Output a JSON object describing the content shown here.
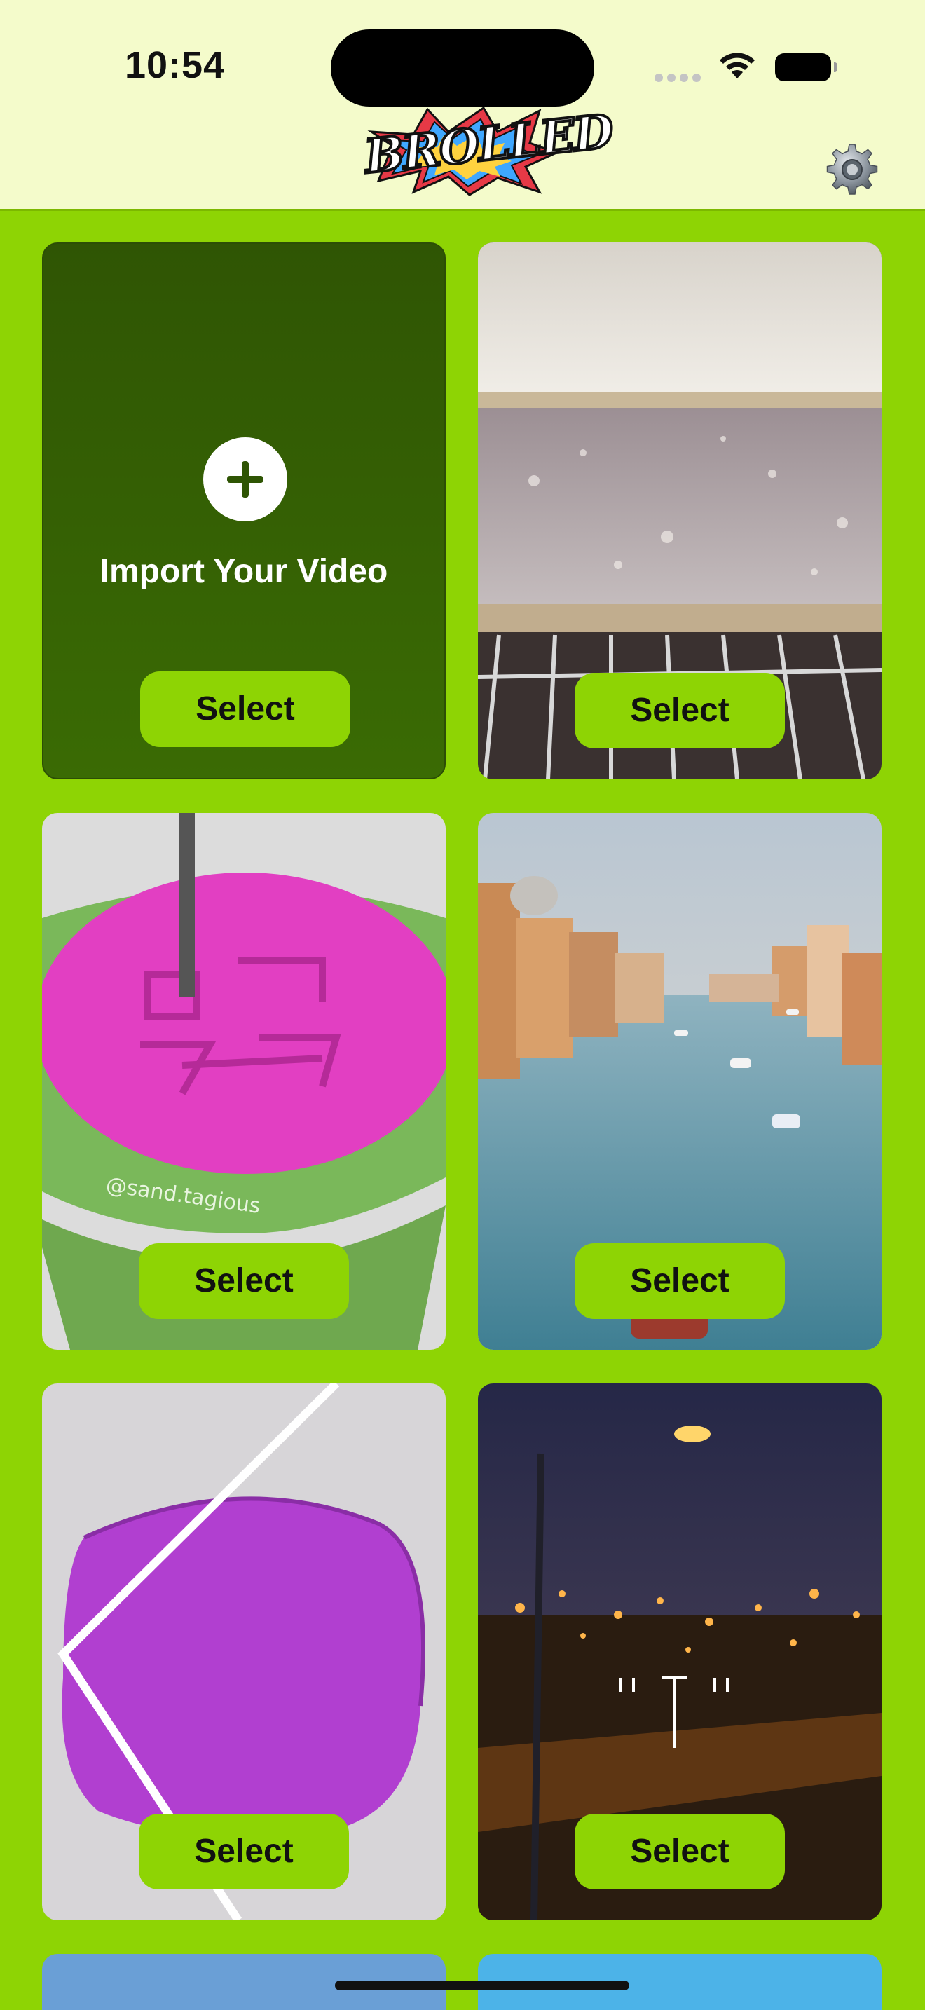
{
  "status_bar": {
    "time": "10:54"
  },
  "header": {
    "logo_text": "BROLLED",
    "settings_icon": "gear-icon"
  },
  "import_card": {
    "label": "Import Your Video",
    "icon": "plus-icon",
    "button": "Select"
  },
  "videos": [
    {
      "scene": "oven-tray",
      "button": "Select"
    },
    {
      "scene": "pink-sand-bowl",
      "watermark": "@sand.tagious",
      "button": "Select"
    },
    {
      "scene": "venice-canal",
      "button": "Select"
    },
    {
      "scene": "purple-sand-cut",
      "button": "Select"
    },
    {
      "scene": "night-street-driving",
      "button": "Select"
    }
  ],
  "colors": {
    "background": "#8ed404",
    "header": "#f4fbcb",
    "import_card": "#2f5504",
    "button": "#8ed404"
  }
}
